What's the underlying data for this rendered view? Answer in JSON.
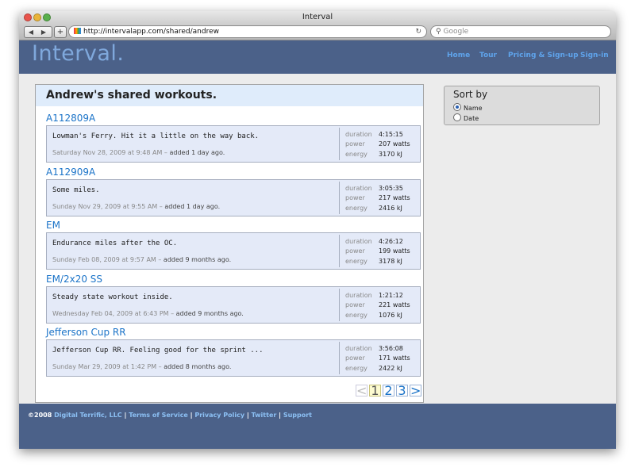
{
  "browser": {
    "window_title": "Interval",
    "back_glyph": "◀",
    "forward_glyph": "▶",
    "add_glyph": "+",
    "url": "http://intervalapp.com/shared/andrew",
    "reload_glyph": "↻",
    "search_glyph": "🔍",
    "search_placeholder": "Google"
  },
  "site": {
    "logo": "Interval.",
    "nav": [
      "Home",
      "Tour",
      "Pricing & Sign-up",
      "Sign-in"
    ]
  },
  "main": {
    "heading": "Andrew's shared workouts.",
    "workouts": [
      {
        "title": "A112809A",
        "description": "Lowman's Ferry. Hit it a little on the way back.",
        "date": "Saturday Nov 28, 2009 at 9:48 AM",
        "added": "added 1 day ago.",
        "duration": "4:15:15",
        "power": "207 watts",
        "energy": "3170 kJ"
      },
      {
        "title": "A112909A",
        "description": "Some miles.",
        "date": "Sunday Nov 29, 2009 at 9:55 AM",
        "added": "added 1 day ago.",
        "duration": "3:05:35",
        "power": "217 watts",
        "energy": "2416 kJ"
      },
      {
        "title": "EM",
        "description": "Endurance miles after the OC.",
        "date": "Sunday Feb 08, 2009 at 9:57 AM",
        "added": "added 9 months ago.",
        "duration": "4:26:12",
        "power": "199 watts",
        "energy": "3178 kJ"
      },
      {
        "title": "EM/2x20 SS",
        "description": "Steady state workout inside.",
        "date": "Wednesday Feb 04, 2009 at 6:43 PM",
        "added": "added 9 months ago.",
        "duration": "1:21:12",
        "power": "221 watts",
        "energy": "1076 kJ"
      },
      {
        "title": "Jefferson Cup RR",
        "description": "Jefferson Cup RR. Feeling good for the sprint ...",
        "date": "Sunday Mar 29, 2009 at 1:42 PM",
        "added": "added 8 months ago.",
        "duration": "3:56:08",
        "power": "171 watts",
        "energy": "2422 kJ"
      }
    ],
    "stat_labels": {
      "duration": "duration",
      "power": "power",
      "energy": "energy"
    },
    "separator": " – ",
    "pagination": {
      "prev": "<",
      "pages": [
        "1",
        "2",
        "3"
      ],
      "current": "1",
      "next": ">"
    }
  },
  "sidebar": {
    "sort_title": "Sort by",
    "options": [
      "Name",
      "Date"
    ],
    "selected": "Name"
  },
  "footer": {
    "copyright": "©2008",
    "company": "Digital Terrific, LLC",
    "links": [
      "Terms of Service",
      "Privacy Policy",
      "Twitter",
      "Support"
    ],
    "divider": " | "
  },
  "colors": {
    "header_bg": "#4b6189",
    "link": "#1a73c8",
    "nav_link": "#5fa4ec",
    "card_bg": "#e4eaf8",
    "heading_bg": "#dfecfb"
  }
}
